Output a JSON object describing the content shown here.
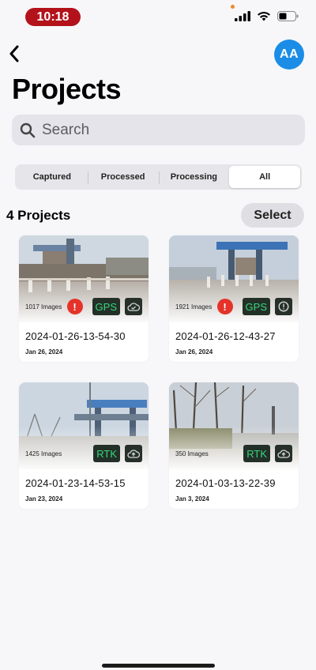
{
  "status_bar": {
    "time": "10:18"
  },
  "header": {
    "avatar_initials": "AA",
    "title": "Projects"
  },
  "search": {
    "placeholder": "Search"
  },
  "segments": [
    {
      "label": "Captured"
    },
    {
      "label": "Processed"
    },
    {
      "label": "Processing"
    },
    {
      "label": "All",
      "active": true
    }
  ],
  "summary": {
    "count_label": "4 Projects",
    "select_label": "Select"
  },
  "projects": [
    {
      "name": "2024-01-26-13-54-30",
      "date": "Jan 26, 2024",
      "images": "1017 Images",
      "tag": "GPS",
      "warning": "!",
      "status_icon": "cloud-check-icon"
    },
    {
      "name": "2024-01-26-12-43-27",
      "date": "Jan 26, 2024",
      "images": "1921 Images",
      "tag": "GPS",
      "warning": "!",
      "status_icon": "alert-circle-icon"
    },
    {
      "name": "2024-01-23-14-53-15",
      "date": "Jan 23, 2024",
      "images": "1425 Images",
      "tag": "RTK",
      "status_icon": "cloud-upload-icon"
    },
    {
      "name": "2024-01-03-13-22-39",
      "date": "Jan 3, 2024",
      "images": "350 Images",
      "tag": "RTK",
      "status_icon": "cloud-upload-icon"
    }
  ],
  "colors": {
    "accent": "#1b8de6",
    "warning": "#e5332a",
    "tag_text": "#38d67a",
    "time_pill": "#b3121b"
  }
}
